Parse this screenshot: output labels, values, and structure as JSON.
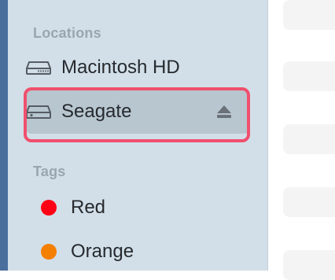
{
  "sidebar": {
    "locations": {
      "header": "Locations",
      "items": [
        {
          "label": "Macintosh HD",
          "icon": "internal-drive-icon"
        },
        {
          "label": "Seagate",
          "icon": "external-drive-icon",
          "selected": true,
          "eject_icon": "eject-icon"
        }
      ]
    },
    "tags": {
      "header": "Tags",
      "items": [
        {
          "label": "Red",
          "color": "#ff0014"
        },
        {
          "label": "Orange",
          "color": "#f57f00"
        }
      ]
    }
  },
  "colors": {
    "sidebar_bg": "#d2dfe8",
    "selection_bg": "#b8c6d0",
    "annotation_border": "#f0506e",
    "window_edge": "#4a6f9d"
  }
}
